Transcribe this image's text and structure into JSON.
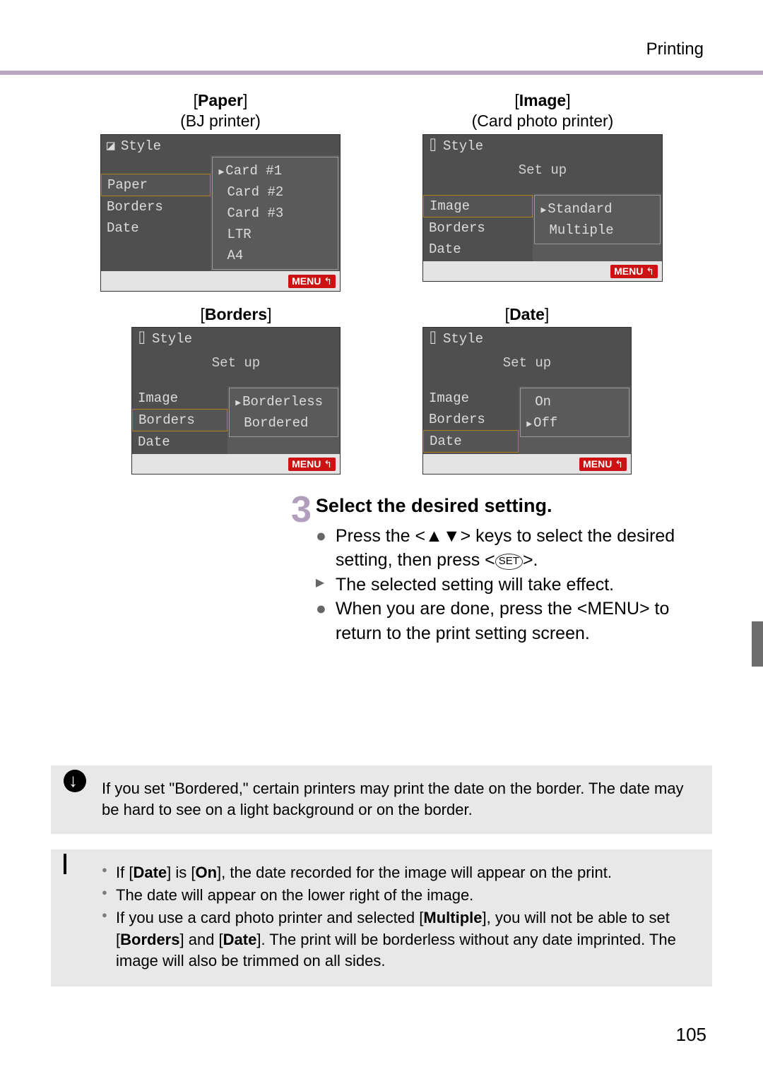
{
  "header": {
    "title": "Printing"
  },
  "screens": {
    "paper": {
      "caption_bold": "Paper",
      "caption_sub": "(BJ printer)",
      "title": "Style",
      "left": [
        "Paper",
        "Borders",
        "Date"
      ],
      "left_sel_index": 0,
      "right": [
        "Card #1",
        "Card #2",
        "Card #3",
        "LTR",
        "A4"
      ],
      "right_sel_index": 0,
      "menu": "MENU"
    },
    "image": {
      "caption_bold": "Image",
      "caption_sub": "(Card photo printer)",
      "title": "Style",
      "setup": "Set up",
      "left": [
        "Image",
        "Borders",
        "Date"
      ],
      "left_sel_index": 0,
      "right": [
        "Standard",
        "Multiple"
      ],
      "right_sel_index": 0,
      "menu": "MENU"
    },
    "borders": {
      "caption_bold": "Borders",
      "title": "Style",
      "setup": "Set up",
      "left": [
        "Image",
        "Borders",
        "Date"
      ],
      "left_sel_index": 1,
      "right": [
        "Borderless",
        "Bordered"
      ],
      "right_sel_index": 0,
      "menu": "MENU"
    },
    "date": {
      "caption_bold": "Date",
      "title": "Style",
      "setup": "Set up",
      "left": [
        "Image",
        "Borders",
        "Date"
      ],
      "left_sel_index": 2,
      "right": [
        "On",
        "Off"
      ],
      "right_sel_index": 1,
      "menu": "MENU"
    }
  },
  "step": {
    "number": "3",
    "heading": "Select the desired setting.",
    "line1a": "Press the <",
    "line1b": "> keys to select the desired setting, then press <",
    "line1c": ">.",
    "arrow_keys": "▲▼",
    "set_key": "SET",
    "line2": "The selected setting will take effect.",
    "line3a": "When you are done, press the <",
    "line3_menu": "MENU",
    "line3b": "> to return to the print setting screen."
  },
  "note1": {
    "text": "If you set \"Bordered,\" certain printers may print the date on the border. The date may be hard to see on a light background or on the border."
  },
  "note2": {
    "b1a": "If [",
    "b1_date": "Date",
    "b1b": "] is [",
    "b1_on": "On",
    "b1c": "], the date recorded for the image will appear on the print.",
    "b2": "The date will appear on the lower right of the image.",
    "b3a": "If you use a card photo printer and selected [",
    "b3_mult": "Multiple",
    "b3b": "], you will not be able to set [",
    "b3_bord": "Borders",
    "b3c": "] and [",
    "b3_date": "Date",
    "b3d": "]. The print will be borderless without any date imprinted. The image will also be trimmed on all sides."
  },
  "page_number": "105"
}
